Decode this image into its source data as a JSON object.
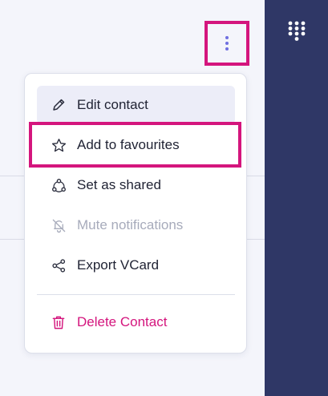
{
  "menu": {
    "items": [
      {
        "label": "Edit contact",
        "icon": "pencil-icon",
        "state": "hovered"
      },
      {
        "label": "Add to favourites",
        "icon": "star-icon",
        "state": "normal"
      },
      {
        "label": "Set as shared",
        "icon": "share-triangle-icon",
        "state": "normal"
      },
      {
        "label": "Mute notifications",
        "icon": "bell-off-icon",
        "state": "disabled"
      },
      {
        "label": "Export VCard",
        "icon": "share-nodes-icon",
        "state": "normal"
      },
      {
        "label": "Delete Contact",
        "icon": "trash-icon",
        "state": "danger"
      }
    ]
  },
  "header": {
    "more_icon": "vertical-dots-icon"
  },
  "rail": {
    "icon": "dialpad-icon"
  },
  "colors": {
    "accent": "#d4157d",
    "rail": "#2f3766",
    "dots": "#6f6fe0",
    "hover_bg": "#ecedf8",
    "disabled_text": "#a7abbb"
  }
}
